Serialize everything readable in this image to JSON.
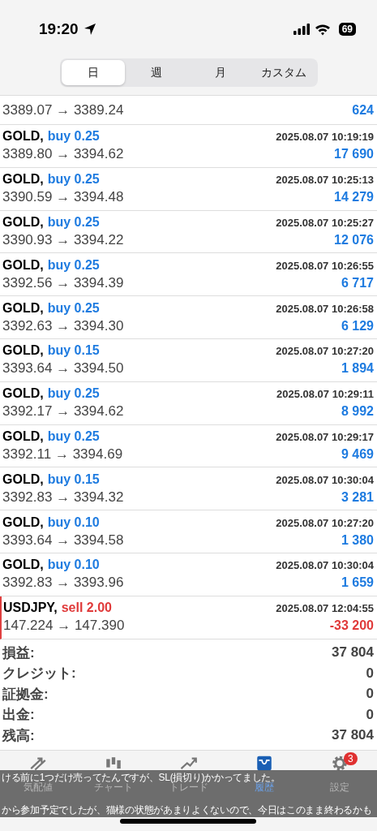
{
  "status_bar": {
    "time": "19:20",
    "battery": "69"
  },
  "tabs": [
    {
      "label": "日",
      "selected": true
    },
    {
      "label": "週",
      "selected": false
    },
    {
      "label": "月",
      "selected": false
    },
    {
      "label": "カスタム",
      "selected": false
    }
  ],
  "partial_row": {
    "prices": "3389.07 → 3389.24",
    "profit": "624",
    "loss": false
  },
  "deals": [
    {
      "symbol": "GOLD,",
      "trade": "buy 0.25",
      "kind": "buy",
      "time": "2025.08.07 10:19:19",
      "prices": "3389.80 → 3394.62",
      "profit": "17 690",
      "loss": false
    },
    {
      "symbol": "GOLD,",
      "trade": "buy 0.25",
      "kind": "buy",
      "time": "2025.08.07 10:25:13",
      "prices": "3390.59 → 3394.48",
      "profit": "14 279",
      "loss": false
    },
    {
      "symbol": "GOLD,",
      "trade": "buy 0.25",
      "kind": "buy",
      "time": "2025.08.07 10:25:27",
      "prices": "3390.93 → 3394.22",
      "profit": "12 076",
      "loss": false
    },
    {
      "symbol": "GOLD,",
      "trade": "buy 0.25",
      "kind": "buy",
      "time": "2025.08.07 10:26:55",
      "prices": "3392.56 → 3394.39",
      "profit": "6 717",
      "loss": false
    },
    {
      "symbol": "GOLD,",
      "trade": "buy 0.25",
      "kind": "buy",
      "time": "2025.08.07 10:26:58",
      "prices": "3392.63 → 3394.30",
      "profit": "6 129",
      "loss": false
    },
    {
      "symbol": "GOLD,",
      "trade": "buy 0.15",
      "kind": "buy",
      "time": "2025.08.07 10:27:20",
      "prices": "3393.64 → 3394.50",
      "profit": "1 894",
      "loss": false
    },
    {
      "symbol": "GOLD,",
      "trade": "buy 0.25",
      "kind": "buy",
      "time": "2025.08.07 10:29:11",
      "prices": "3392.17 → 3394.62",
      "profit": "8 992",
      "loss": false
    },
    {
      "symbol": "GOLD,",
      "trade": "buy 0.25",
      "kind": "buy",
      "time": "2025.08.07 10:29:17",
      "prices": "3392.11 → 3394.69",
      "profit": "9 469",
      "loss": false
    },
    {
      "symbol": "GOLD,",
      "trade": "buy 0.15",
      "kind": "buy",
      "time": "2025.08.07 10:30:04",
      "prices": "3392.83 → 3394.32",
      "profit": "3 281",
      "loss": false
    },
    {
      "symbol": "GOLD,",
      "trade": "buy 0.10",
      "kind": "buy",
      "time": "2025.08.07 10:27:20",
      "prices": "3393.64 → 3394.58",
      "profit": "1 380",
      "loss": false
    },
    {
      "symbol": "GOLD,",
      "trade": "buy 0.10",
      "kind": "buy",
      "time": "2025.08.07 10:30:04",
      "prices": "3392.83 → 3393.96",
      "profit": "1 659",
      "loss": false
    },
    {
      "symbol": "USDJPY,",
      "trade": "sell 2.00",
      "kind": "sell",
      "time": "2025.08.07 12:04:55",
      "prices": "147.224 → 147.390",
      "profit": "-33 200",
      "loss": true
    }
  ],
  "summary": [
    {
      "label": "損益:",
      "value": "37 804"
    },
    {
      "label": "クレジット:",
      "value": "0"
    },
    {
      "label": "証拠金:",
      "value": "0"
    },
    {
      "label": "出金:",
      "value": "0"
    },
    {
      "label": "残高:",
      "value": "37 804"
    }
  ],
  "bottom_tabs": [
    {
      "label": "気配値",
      "kind": "quotes",
      "selected": false
    },
    {
      "label": "チャート",
      "kind": "chart",
      "selected": false
    },
    {
      "label": "トレード",
      "kind": "trade",
      "selected": false
    },
    {
      "label": "履歴",
      "kind": "history",
      "selected": true
    },
    {
      "label": "設定",
      "kind": "settings",
      "selected": false,
      "badge": "3"
    }
  ],
  "subtitles": [
    "ける前に1つだけ売ってたんですが、SL(損切り)かかってました。",
    "から参加予定でしたが、猫様の状態があまりよくないので、今日はこのまま終わるかも"
  ]
}
